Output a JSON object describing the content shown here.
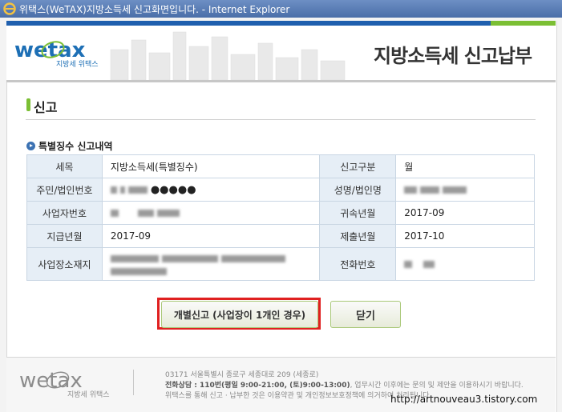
{
  "window": {
    "title": "위택스(WeTAX)지방소득세 신고화면입니다. - Internet Explorer"
  },
  "header": {
    "logo_text": "wetax",
    "logo_sub": "지방세 위택스",
    "title": "지방소득세 신고납부"
  },
  "section": {
    "title": "신고",
    "subtitle": "특별징수 신고내역"
  },
  "table": {
    "tax_item_label": "세목",
    "tax_item_value": "지방소득세(특별징수)",
    "report_type_label": "신고구분",
    "report_type_value": "월",
    "resident_id_label": "주민/법인번호",
    "resident_id_mask": "●●●●●",
    "name_label": "성명/법인명",
    "business_no_label": "사업자번호",
    "belong_month_label": "귀속년월",
    "belong_month_value": "2017-09",
    "pay_month_label": "지급년월",
    "pay_month_value": "2017-09",
    "submit_month_label": "제출년월",
    "submit_month_value": "2017-10",
    "address_label": "사업장소재지",
    "phone_label": "전화번호"
  },
  "buttons": {
    "individual_label": "개별신고 (사업장이 1개인 경우)",
    "close_label": "닫기"
  },
  "footer": {
    "logo_text": "wetax",
    "logo_sub": "지방세 위택스",
    "address": "03171 서울특별시 종로구 세종대로 209 (세종로)",
    "phone_bold": "전화상담 : 110번(평일 9:00-21:00, (토)9:00-13:00)",
    "phone_rest": ", 업무시간 이후에는 문의 및 제안을 이용하시기 바랍니다.",
    "notice": "위택스를 통해 신고 · 납부한 것은 이용약관 및 개인정보보호정책에 의거하여 처리됩니다."
  },
  "watermark": "http://artnouveau3.tistory.com",
  "colors": {
    "brand_blue": "#1f5fae",
    "brand_green": "#7bbf34",
    "highlight_red": "#e02020"
  }
}
